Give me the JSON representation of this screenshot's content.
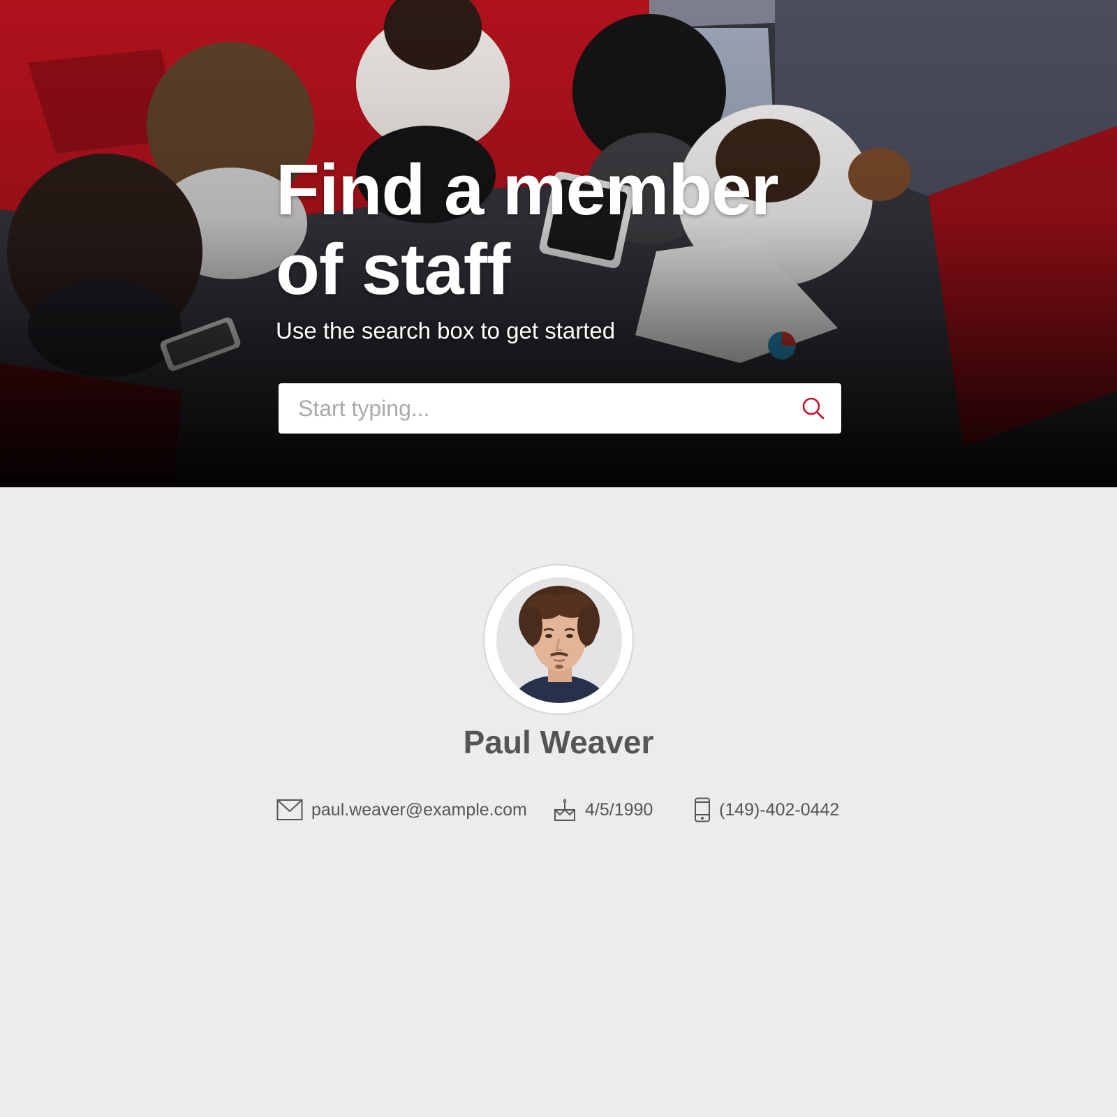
{
  "hero": {
    "title_line1": "Find a member",
    "title_line2": "of staff",
    "subtitle": "Use the search box to get started",
    "search": {
      "placeholder": "Start typing...",
      "value": ""
    }
  },
  "profile": {
    "name": "Paul Weaver",
    "email": "paul.weaver@example.com",
    "birthday": "4/5/1990",
    "phone": "(149)-402-0442"
  },
  "icons": {
    "search": "search-icon",
    "email": "envelope-icon",
    "birthday": "birthday-cake-icon",
    "phone": "mobile-phone-icon"
  },
  "colors": {
    "accent": "#c8102e",
    "page_background": "#ececec",
    "text": "#555555"
  }
}
